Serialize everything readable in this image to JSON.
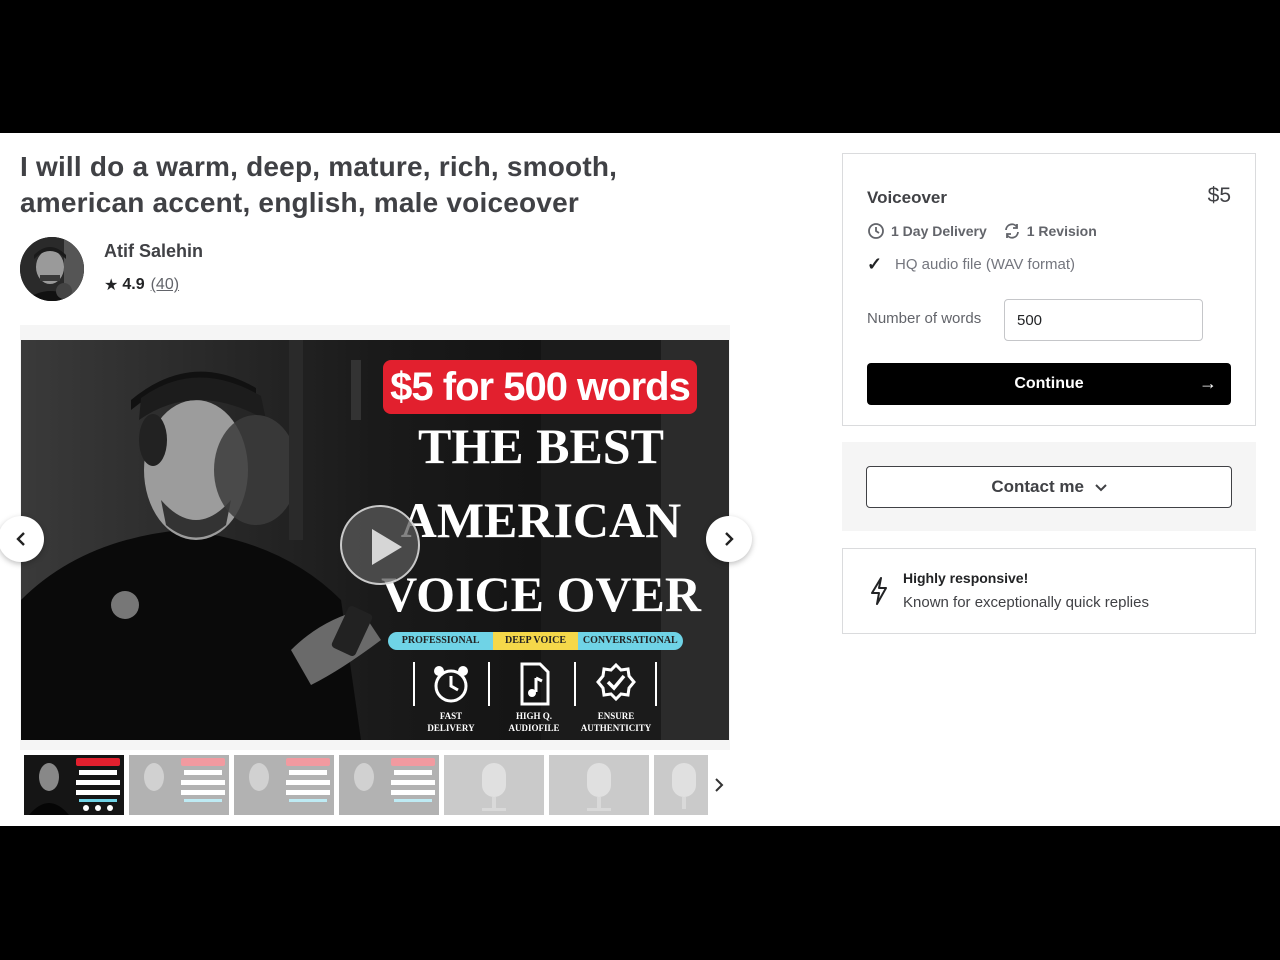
{
  "gig": {
    "title": "I will do a warm, deep, mature, rich, smooth, american accent, english, male voiceover"
  },
  "seller": {
    "name": "Atif Salehin",
    "rating": "4.9",
    "review_count": "(40)"
  },
  "gallery": {
    "promo_price": "$5 for 500 words",
    "promo_lines": [
      "THE BEST",
      "AMERICAN",
      "VOICE OVER"
    ],
    "tags": [
      "PROFESSIONAL",
      "DEEP VOICE",
      "CONVERSATIONAL"
    ],
    "features": [
      {
        "line1": "FAST",
        "line2": "DELIVERY",
        "icon": "alarm-clock-icon"
      },
      {
        "line1": "HIGH Q.",
        "line2": "AUDIOFILE",
        "icon": "audio-file-icon"
      },
      {
        "line1": "ENSURE",
        "line2": "AUTHENTICITY",
        "icon": "badge-check-icon"
      }
    ],
    "thumb_count": 7
  },
  "package": {
    "name": "Voiceover",
    "price": "$5",
    "delivery": "1 Day Delivery",
    "revisions": "1 Revision",
    "feature": "HQ audio file (WAV format)",
    "words_label": "Number of words",
    "words_value": "500",
    "continue_label": "Continue"
  },
  "contact": {
    "label": "Contact me"
  },
  "responsive": {
    "title": "Highly responsive!",
    "subtitle": "Known for exceptionally quick replies"
  },
  "colors": {
    "accent_red": "#e2202e",
    "tag_blue": "#6fd3e6",
    "tag_yellow": "#f5d84a",
    "button_black": "#000000"
  }
}
